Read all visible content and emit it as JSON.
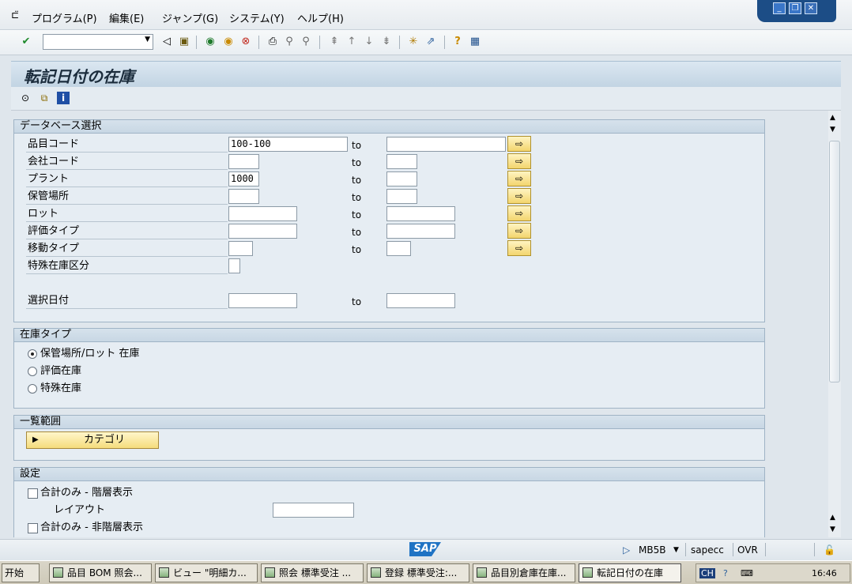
{
  "menu": {
    "items": [
      "プログラム(P)",
      "編集(E)",
      "ジャンプ(G)",
      "システム(Y)",
      "ヘルプ(H)"
    ]
  },
  "toolbar": {
    "command_value": ""
  },
  "page_title": "転記日付の在庫",
  "sections": {
    "database": {
      "title": "データベース選択",
      "rows": [
        {
          "label": "品目コード",
          "from": "100-100",
          "to_label": "to",
          "to": ""
        },
        {
          "label": "会社コード",
          "from": "",
          "to_label": "to",
          "to": ""
        },
        {
          "label": "プラント",
          "from": "1000",
          "to_label": "to",
          "to": ""
        },
        {
          "label": "保管場所",
          "from": "",
          "to_label": "to",
          "to": ""
        },
        {
          "label": "ロット",
          "from": "",
          "to_label": "to",
          "to": ""
        },
        {
          "label": "評価タイプ",
          "from": "",
          "to_label": "to",
          "to": ""
        },
        {
          "label": "移動タイプ",
          "from": "",
          "to_label": "to",
          "to": ""
        },
        {
          "label": "特殊在庫区分",
          "from": ""
        },
        {
          "label": "選択日付",
          "from": "",
          "to_label": "to",
          "to": ""
        }
      ]
    },
    "stock_type": {
      "title": "在庫タイプ",
      "options": [
        "保管場所/ロット 在庫",
        "評価在庫",
        "特殊在庫"
      ],
      "selected": "保管場所/ロット 在庫"
    },
    "list_scope": {
      "title": "一覧範囲",
      "button_label": "カテゴリ"
    },
    "settings": {
      "title": "設定",
      "check1": "合計のみ - 階層表示",
      "layout_label": "レイアウト",
      "layout_value": "",
      "check2": "合計のみ - 非階層表示"
    }
  },
  "statusbar": {
    "logo": "SAP",
    "tcode": "MB5B",
    "server": "sapecc",
    "mode": "OVR"
  },
  "taskbar": {
    "start": "开始",
    "tasks": [
      "品目 BOM 照会...",
      "ビュー \"明細カ...",
      "照会 標準受注 ...",
      "登録 標準受注:...",
      "品目別倉庫在庫...",
      "転記日付の在庫"
    ],
    "tray_text": "CH",
    "clock": "16:46"
  }
}
